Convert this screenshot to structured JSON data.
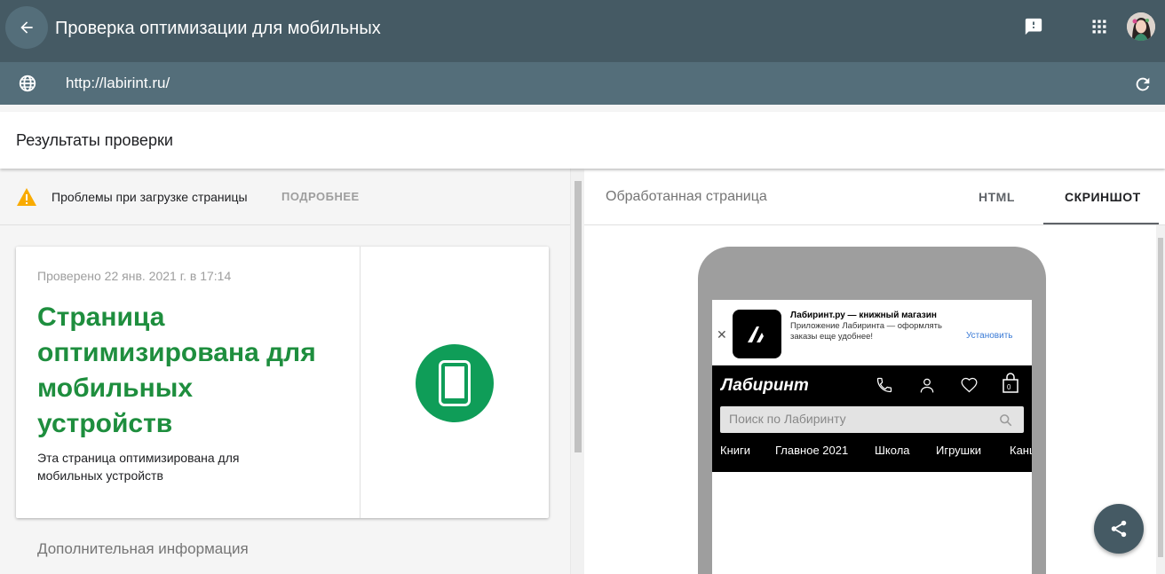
{
  "header": {
    "title": "Проверка оптимизации для мобильных",
    "back_icon": "arrow-back-icon",
    "feedback_icon": "feedback-icon",
    "apps_icon": "apps-grid-icon",
    "avatar": "user-avatar"
  },
  "url_bar": {
    "url": "http://labirint.ru/",
    "globe_icon": "globe-icon",
    "refresh_icon": "refresh-icon"
  },
  "results": {
    "title": "Результаты проверки"
  },
  "warning": {
    "text": "Проблемы при загрузке страницы",
    "link": "ПОДРОБНЕЕ",
    "icon": "warning-icon",
    "color": "#f9ab00"
  },
  "result_card": {
    "checked": "Проверено 22 янв. 2021 г. в 17:14",
    "verdict": "Страница оптимизирована для мобильных устройств",
    "description": "Эта страница оптимизирована для мобильных устройств",
    "status_color": "#0f9d58",
    "icon": "smartphone-icon"
  },
  "extra": {
    "title": "Дополнительная информация"
  },
  "preview": {
    "title": "Обработанная страница",
    "tabs": [
      "HTML",
      "СКРИНШОТ"
    ],
    "active_tab": "СКРИНШОТ"
  },
  "site": {
    "banner": {
      "close": "✕",
      "title": "Лабиринт.ру — книжный магазин",
      "desc": "Приложение Лабиринта — оформлять заказы еще удобнее!",
      "install": "Установить"
    },
    "logo": "Лабиринт",
    "cart_count": "0",
    "search_placeholder": "Поиск по Лабиринту",
    "nav": [
      "Книги",
      "Главное 2021",
      "Школа",
      "Игрушки",
      "Канц"
    ]
  },
  "share": {
    "icon": "share-icon"
  }
}
